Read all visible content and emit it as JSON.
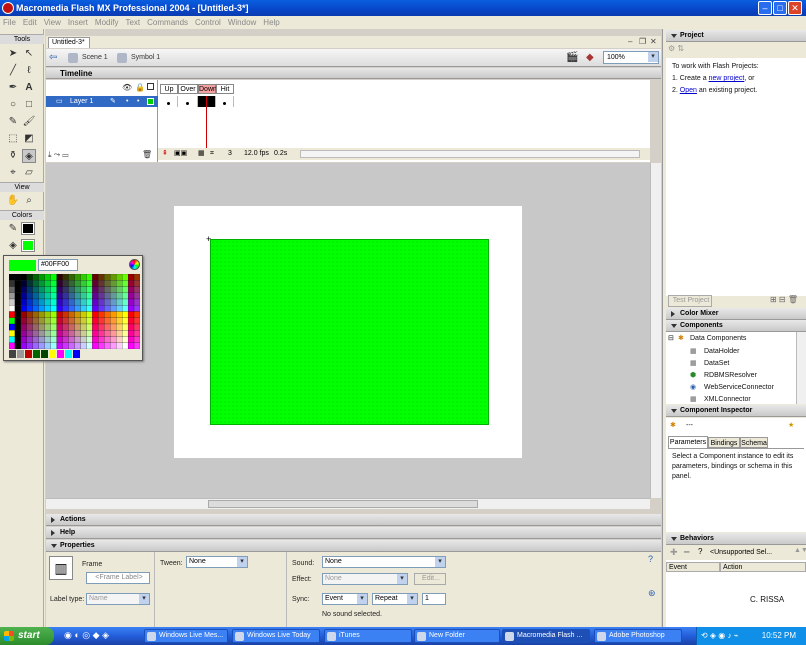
{
  "window": {
    "title": "Macromedia Flash MX Professional 2004 - [Untitled-3*]"
  },
  "menu": [
    "File",
    "Edit",
    "View",
    "Insert",
    "Modify",
    "Text",
    "Commands",
    "Control",
    "Window",
    "Help"
  ],
  "tools": {
    "section_tools": "Tools",
    "section_view": "View",
    "section_colors": "Colors"
  },
  "document": {
    "tab": "Untitled-3*",
    "breadcrumb_scene": "Scene 1",
    "breadcrumb_symbol": "Symbol 1",
    "zoom": "100%"
  },
  "timeline": {
    "title": "Timeline",
    "layer_name": "Layer 1",
    "frame_labels": [
      "Up",
      "Over",
      "Down",
      "Hit"
    ],
    "current_frame": "3",
    "fps": "12.0 fps",
    "elapsed": "0.2s"
  },
  "color_picker": {
    "hex": "#00FF00"
  },
  "panels": {
    "actions": "Actions",
    "help": "Help",
    "properties": "Properties"
  },
  "properties": {
    "type": "Frame",
    "frame_label_placeholder": "<Frame Label>",
    "label_type_label": "Label type:",
    "label_type_value": "Name",
    "tween_label": "Tween:",
    "tween_value": "None",
    "sound_label": "Sound:",
    "sound_value": "None",
    "effect_label": "Effect:",
    "effect_value": "None",
    "edit_button": "Edit...",
    "sync_label": "Sync:",
    "sync_value": "Event",
    "repeat_value": "Repeat",
    "repeat_count": "1",
    "sound_status": "No sound selected."
  },
  "project": {
    "title": "Project",
    "intro": "To work with Flash Projects:",
    "step1_prefix": "1. Create a ",
    "step1_link": "new project",
    "step1_suffix": ", or",
    "step2_prefix": "2. ",
    "step2_link": "Open",
    "step2_suffix": " an existing project.",
    "test_button": "Test Project"
  },
  "color_mixer": {
    "title": "Color Mixer"
  },
  "components": {
    "title": "Components",
    "category": "Data Components",
    "items": [
      "DataHolder",
      "DataSet",
      "RDBMSResolver",
      "WebServiceConnector",
      "XMLConnector"
    ]
  },
  "inspector": {
    "title": "Component Inspector",
    "value": "---",
    "tabs": [
      "Parameters",
      "Bindings",
      "Schema"
    ],
    "message": "Select a Component instance to edit its parameters, bindings or schema in this panel."
  },
  "behaviors": {
    "title": "Behaviors",
    "dropdown": "<Unsupported Sel...",
    "columns": [
      "Event",
      "Action"
    ],
    "watermark": "C. RISSA"
  },
  "taskbar": {
    "start": "start",
    "tasks": [
      "Windows Live Mes...",
      "Windows Live Today",
      "iTunes",
      "New Folder",
      "Macromedia Flash ...",
      "Adobe Photoshop"
    ],
    "clock": "10:52 PM"
  },
  "colors": {
    "fill": "#00ff00",
    "accent": "#316ac5",
    "titlebar": "#0846c8"
  }
}
